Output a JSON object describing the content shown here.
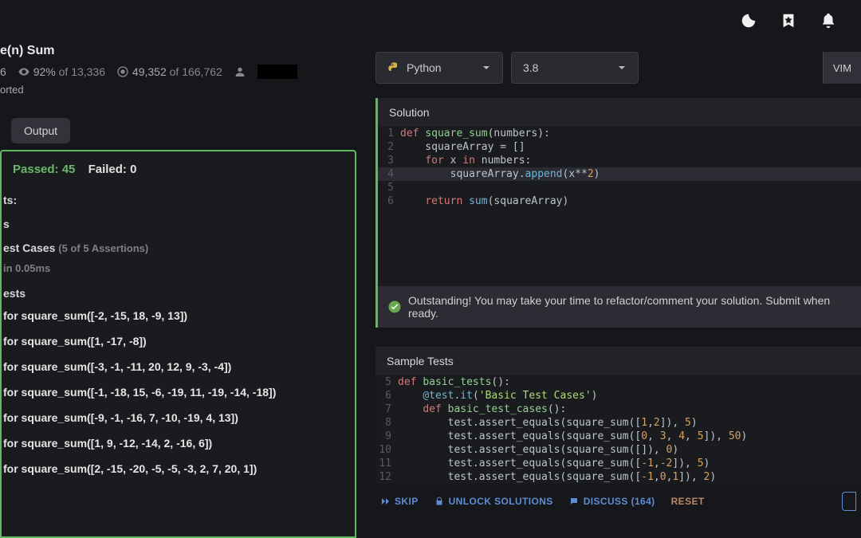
{
  "kata": {
    "title_fragment": "e(n) Sum",
    "rank_fragment": "6",
    "satisfaction_pct": "92%",
    "satisfaction_of_label": "of",
    "satisfaction_total": "13,336",
    "completed": "49,352",
    "completed_of_label": "of",
    "completed_total": "166,762",
    "imported_label": "orted"
  },
  "tabs": {
    "output": "Output"
  },
  "results": {
    "passed_label": "Passed: 45",
    "failed_label": "Failed: 0",
    "tests_heading": "ts:",
    "s_label": "s",
    "basic_heading": "est Cases",
    "basic_count": "(5 of 5 Assertions)",
    "timing": " in 0.05ms",
    "random_heading": "ests",
    "lines": [
      "for square_sum([-2, -15, 18, -9, 13])",
      "for square_sum([1, -17, -8])",
      "for square_sum([-3, -1, -11, 20, 12, 9, -3, -4])",
      "for square_sum([-1, -18, 15, -6, -19, 11, -19, -14, -18])",
      "for square_sum([-9, -1, -16, 7, -10, -19, 4, 13])",
      "for square_sum([1, 9, -12, -14, 2, -16, 6])",
      "for square_sum([2, -15, -20, -5, -5, -3, 2, 7, 20, 1])"
    ]
  },
  "controls": {
    "language": "Python",
    "version": "3.8",
    "vim": "VIM"
  },
  "solution": {
    "header": "Solution"
  },
  "success": {
    "message": "Outstanding! You may take your time to refactor/comment your solution. Submit when ready."
  },
  "sample": {
    "header": "Sample Tests"
  },
  "actions": {
    "skip": "SKIP",
    "unlock": "UNLOCK SOLUTIONS",
    "discuss": "DISCUSS (164)",
    "reset": "RESET"
  }
}
